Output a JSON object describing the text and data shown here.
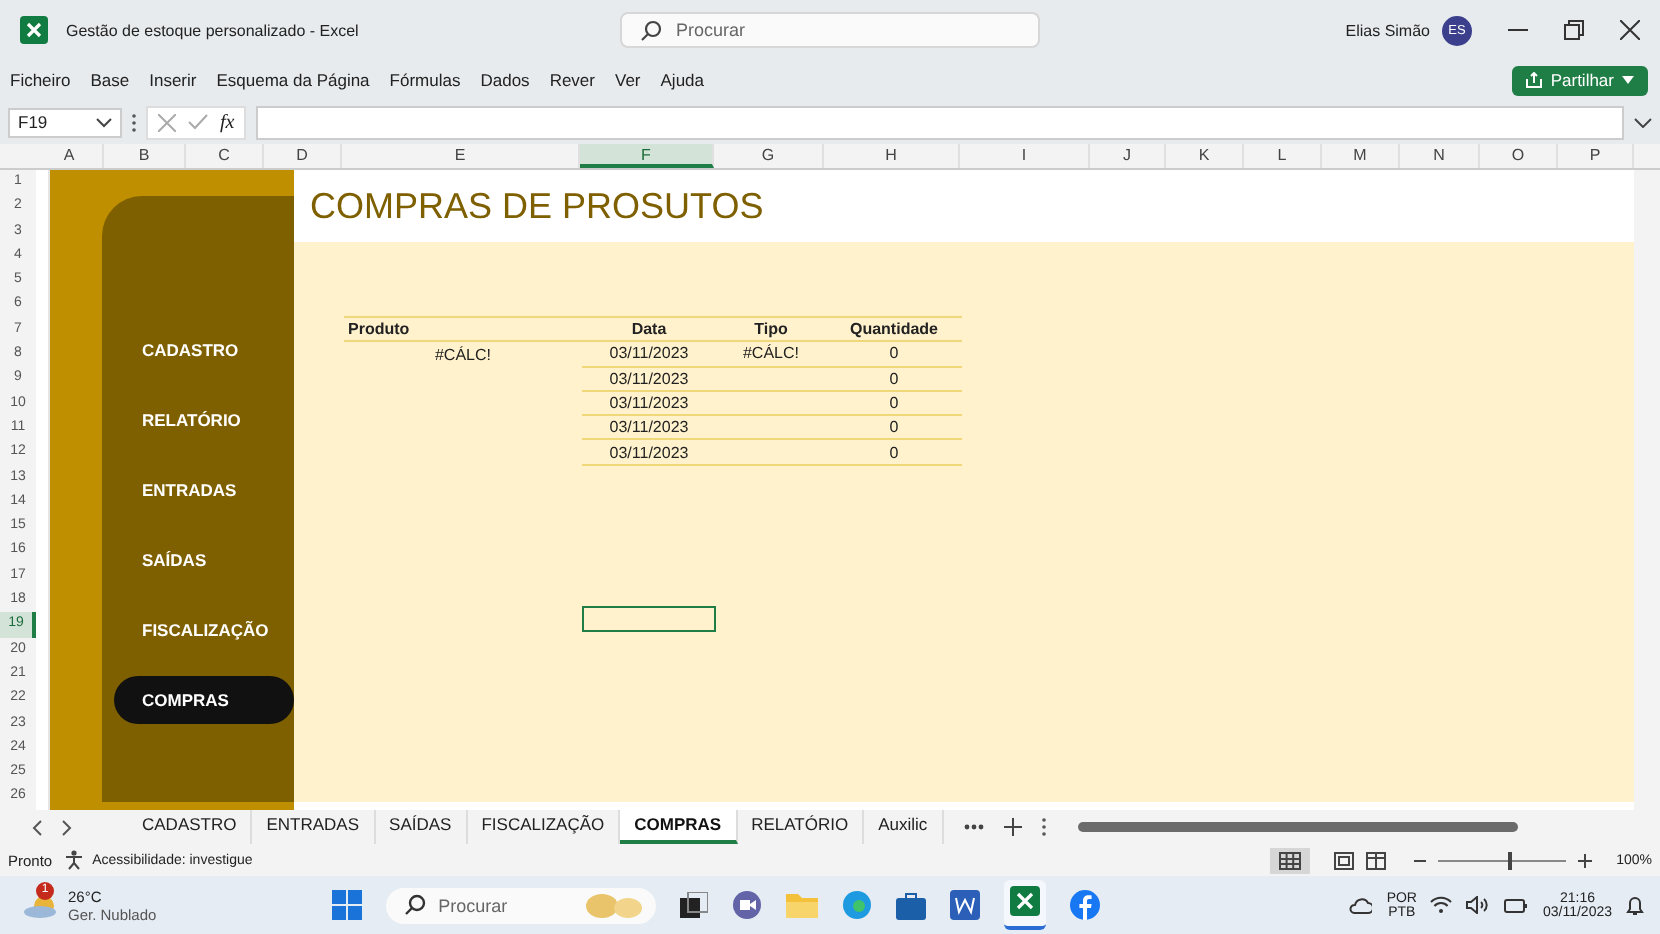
{
  "window": {
    "title": "Gestão de estoque personalizado  -  Excel",
    "search_placeholder": "Procurar",
    "user_name": "Elias Simão",
    "user_initials": "ES"
  },
  "menu": {
    "items": [
      "Ficheiro",
      "Base",
      "Inserir",
      "Esquema da Página",
      "Fórmulas",
      "Dados",
      "Rever",
      "Ver",
      "Ajuda"
    ],
    "share_button": "Partilhar"
  },
  "formula_bar": {
    "name_box": "F19",
    "function_label": "fx"
  },
  "columns": [
    {
      "label": "A",
      "selected": false
    },
    {
      "label": "B",
      "selected": false
    },
    {
      "label": "C",
      "selected": false
    },
    {
      "label": "D",
      "selected": false
    },
    {
      "label": "E",
      "selected": false
    },
    {
      "label": "F",
      "selected": true
    },
    {
      "label": "G",
      "selected": false
    },
    {
      "label": "H",
      "selected": false
    },
    {
      "label": "I",
      "selected": false
    },
    {
      "label": "J",
      "selected": false
    },
    {
      "label": "K",
      "selected": false
    },
    {
      "label": "L",
      "selected": false
    },
    {
      "label": "M",
      "selected": false
    },
    {
      "label": "N",
      "selected": false
    },
    {
      "label": "O",
      "selected": false
    },
    {
      "label": "P",
      "selected": false
    }
  ],
  "rows": [
    {
      "label": "1",
      "selected": false
    },
    {
      "label": "2",
      "selected": false
    },
    {
      "label": "3",
      "selected": false
    },
    {
      "label": "4",
      "selected": false
    },
    {
      "label": "5",
      "selected": false
    },
    {
      "label": "6",
      "selected": false
    },
    {
      "label": "7",
      "selected": false
    },
    {
      "label": "8",
      "selected": false
    },
    {
      "label": "9",
      "selected": false
    },
    {
      "label": "10",
      "selected": false
    },
    {
      "label": "11",
      "selected": false
    },
    {
      "label": "12",
      "selected": false
    },
    {
      "label": "13",
      "selected": false
    },
    {
      "label": "14",
      "selected": false
    },
    {
      "label": "15",
      "selected": false
    },
    {
      "label": "16",
      "selected": false
    },
    {
      "label": "17",
      "selected": false
    },
    {
      "label": "18",
      "selected": false
    },
    {
      "label": "19",
      "selected": true
    },
    {
      "label": "20",
      "selected": false
    },
    {
      "label": "21",
      "selected": false
    },
    {
      "label": "22",
      "selected": false
    },
    {
      "label": "23",
      "selected": false
    },
    {
      "label": "24",
      "selected": false
    },
    {
      "label": "25",
      "selected": false
    },
    {
      "label": "26",
      "selected": false
    }
  ],
  "sheet": {
    "title": "COMPRAS DE PROSUTOS",
    "nav": [
      {
        "label": "CADASTRO",
        "selected": false
      },
      {
        "label": "RELATÓRIO",
        "selected": false
      },
      {
        "label": "ENTRADAS",
        "selected": false
      },
      {
        "label": "SAÍDAS",
        "selected": false
      },
      {
        "label": "FISCALIZAÇÃO",
        "selected": false
      },
      {
        "label": "COMPRAS",
        "selected": true
      }
    ],
    "table": {
      "columns": [
        "Produto",
        "Data",
        "Tipo",
        "Quantidade"
      ],
      "rows": [
        {
          "produto": "#CÁLC!",
          "data": "03/11/2023",
          "tipo": "#CÁLC!",
          "quantidade": "0"
        },
        {
          "data": "03/11/2023",
          "quantidade": "0"
        },
        {
          "data": "03/11/2023",
          "quantidade": "0"
        },
        {
          "data": "03/11/2023",
          "quantidade": "0"
        },
        {
          "data": "03/11/2023",
          "quantidade": "0"
        }
      ]
    }
  },
  "sheet_tabs": [
    {
      "label": "CADASTRO",
      "selected": false
    },
    {
      "label": "ENTRADAS",
      "selected": false
    },
    {
      "label": "SAÍDAS",
      "selected": false
    },
    {
      "label": "FISCALIZAÇÃO",
      "selected": false
    },
    {
      "label": "COMPRAS",
      "selected": true
    },
    {
      "label": "RELATÓRIO",
      "selected": false
    },
    {
      "label": "Auxilic",
      "selected": false
    }
  ],
  "status_bar": {
    "ready": "Pronto",
    "accessibility": "Acessibilidade: investigue",
    "zoom": "100%",
    "zoom_slider": {
      "level": 0.55
    }
  },
  "taskbar": {
    "weather_badge": "1",
    "temperature": "26°C",
    "condition": "Ger. Nublado",
    "search_placeholder": "Procurar",
    "language": "POR",
    "layout": "PTB",
    "time": "21:16",
    "date": "03/11/2023"
  }
}
